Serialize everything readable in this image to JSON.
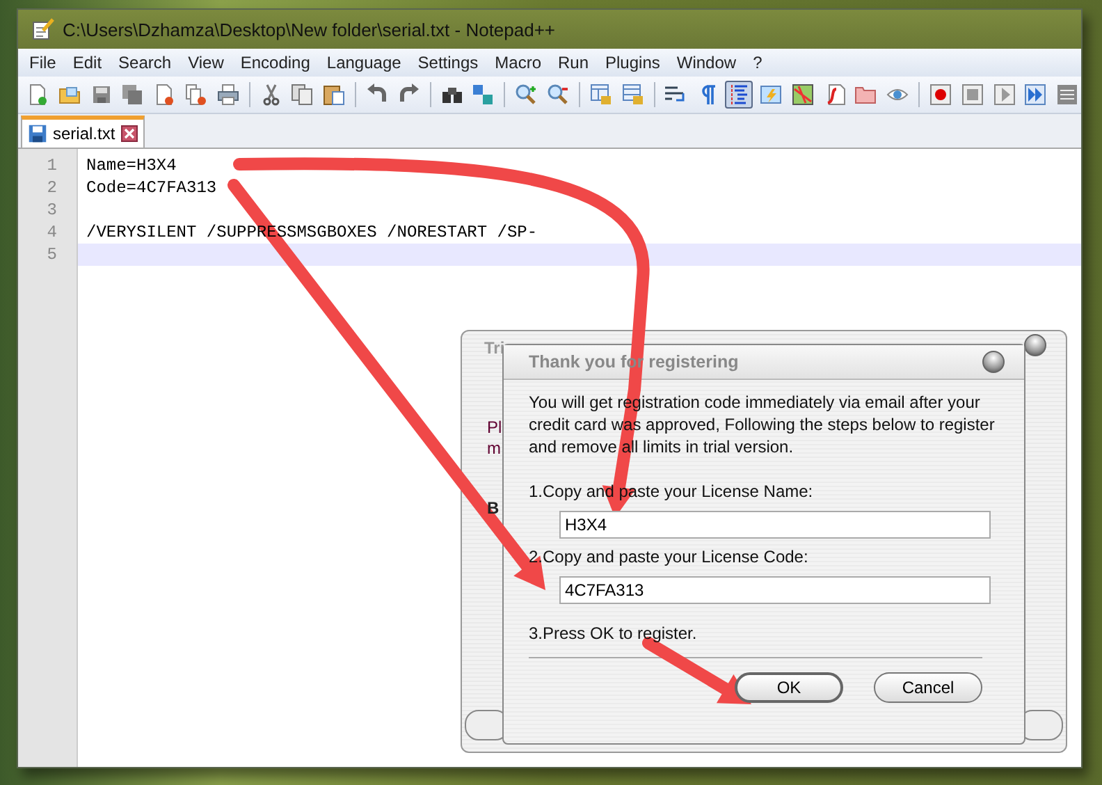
{
  "window": {
    "title": "C:\\Users\\Dzhamza\\Desktop\\New folder\\serial.txt - Notepad++"
  },
  "menu": [
    "File",
    "Edit",
    "Search",
    "View",
    "Encoding",
    "Language",
    "Settings",
    "Macro",
    "Run",
    "Plugins",
    "Window",
    "?"
  ],
  "toolbar_buttons": [
    {
      "pressed": false
    },
    {
      "pressed": false
    },
    {
      "pressed": false
    },
    {
      "pressed": false
    },
    {
      "pressed": false
    },
    {
      "pressed": false
    },
    {
      "pressed": false
    },
    {
      "pressed": false
    },
    {
      "pressed": false
    },
    {
      "pressed": false
    },
    {
      "pressed": false
    },
    {
      "pressed": false
    },
    {
      "pressed": false
    },
    {
      "pressed": false
    },
    {
      "pressed": false
    },
    {
      "pressed": false
    },
    {
      "pressed": false
    },
    {
      "pressed": false
    },
    {
      "pressed": false
    },
    {
      "pressed": false
    },
    {
      "pressed": true
    },
    {
      "pressed": false
    },
    {
      "pressed": false
    },
    {
      "pressed": false
    },
    {
      "pressed": false
    },
    {
      "pressed": false
    },
    {
      "pressed": false
    },
    {
      "pressed": false
    },
    {
      "pressed": false
    },
    {
      "pressed": false
    },
    {
      "pressed": false
    }
  ],
  "tabs": [
    {
      "label": "serial.txt",
      "selected": true
    }
  ],
  "editor": {
    "lines": [
      {
        "number": "1",
        "text": "Name=H3X4",
        "current": false
      },
      {
        "number": "2",
        "text": "Code=4C7FA313",
        "current": false
      },
      {
        "number": "3",
        "current": false
      },
      {
        "number": "4",
        "text": "/VERYSILENT /SUPPRESSMSGBOXES /NORESTART /SP-",
        "current": false
      },
      {
        "number": "5",
        "current": true
      }
    ]
  },
  "background_dialog": {
    "title": "Tri",
    "texts": [
      {
        "text": "Pl",
        "bold": false
      },
      {
        "text": "m",
        "bold": false
      },
      {
        "text": "B",
        "bold": true
      }
    ]
  },
  "dialog": {
    "title": "Thank you for registering",
    "message": "You will get registration code immediately via email after your credit card was approved, Following the steps below to register and remove all limits in trial version.",
    "step_1": "1.Copy and paste your License Name:",
    "name_value": "H3X4",
    "step_2": "2.Copy and paste your License Code:",
    "code_value": "4C7FA313",
    "step_3": "3.Press OK to register.",
    "buttons": [
      {
        "label": "OK",
        "default": true
      },
      {
        "label": "Cancel",
        "default": false
      }
    ]
  }
}
